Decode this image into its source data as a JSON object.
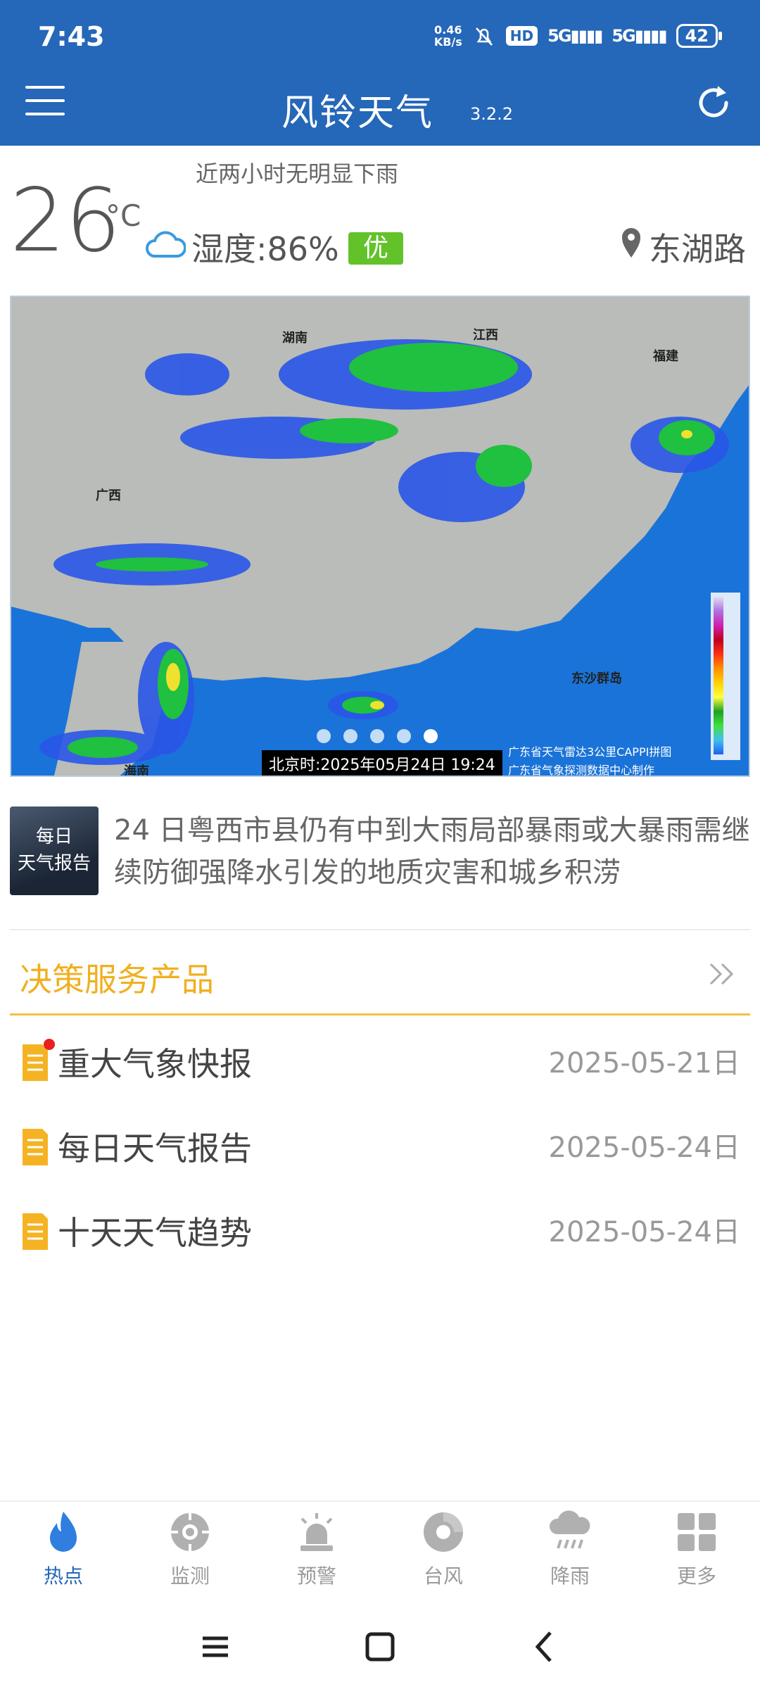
{
  "status_bar": {
    "time": "7:43",
    "net_speed_value": "0.46",
    "net_speed_unit": "KB/s",
    "hd_badge": "HD",
    "signal1": "5G",
    "signal2": "5G",
    "battery": "42"
  },
  "header": {
    "title": "风铃天气",
    "version": "3.2.2"
  },
  "current": {
    "nowcast": "近两小时无明显下雨",
    "temperature": "26",
    "unit": "°C",
    "humidity": "湿度:86%",
    "aqi": "优",
    "location": "东湖路"
  },
  "radar": {
    "labels": {
      "hunan": "湖南",
      "jiangxi": "江西",
      "fujian": "福建",
      "guangxi": "广西",
      "hainan": "海南",
      "dongsha": "东沙群岛"
    },
    "timestamp": "北京时:2025年05月24日 19:24",
    "credit_line1": "广东省天气雷达3公里CAPPI拼图",
    "credit_line2": "广东省气象探测数据中心制作"
  },
  "headline": {
    "thumb_line1": "每日",
    "thumb_line2": "天气报告",
    "text": "24 日粤西市县仍有中到大雨局部暴雨或大暴雨需继续防御强降水引发的地质灾害和城乡积涝"
  },
  "decision": {
    "title": "决策服务产品",
    "items": [
      {
        "name": "重大气象快报",
        "date": "2025-05-21日"
      },
      {
        "name": "每日天气报告",
        "date": "2025-05-24日"
      },
      {
        "name": "十天天气趋势",
        "date": "2025-05-24日"
      }
    ]
  },
  "bottom_nav": [
    {
      "label": "热点",
      "icon": "flame-icon"
    },
    {
      "label": "监测",
      "icon": "monitor-icon"
    },
    {
      "label": "预警",
      "icon": "alarm-icon"
    },
    {
      "label": "台风",
      "icon": "typhoon-icon"
    },
    {
      "label": "降雨",
      "icon": "rain-icon"
    },
    {
      "label": "更多",
      "icon": "grid-icon"
    }
  ],
  "colors": {
    "primary": "#2567b8",
    "accent": "#f0b020",
    "aqi_good": "#62c22a",
    "alert_dot": "#e82020"
  }
}
